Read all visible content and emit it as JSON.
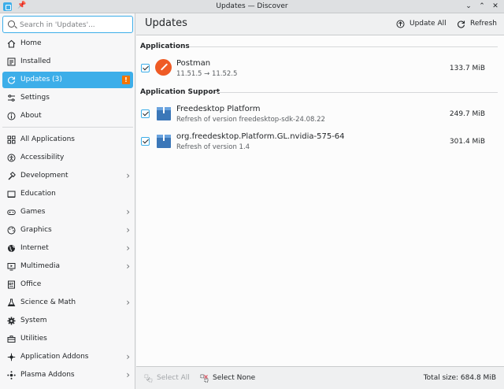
{
  "window": {
    "title": "Updates — Discover"
  },
  "search": {
    "placeholder": "Search in 'Updates'..."
  },
  "sidebar": {
    "items": [
      {
        "id": "home",
        "label": "Home",
        "icon": "home-icon"
      },
      {
        "id": "installed",
        "label": "Installed",
        "icon": "installed-icon"
      },
      {
        "id": "updates",
        "label": "Updates (3)",
        "icon": "updates-icon",
        "badge": "!"
      },
      {
        "id": "settings",
        "label": "Settings",
        "icon": "settings-icon"
      },
      {
        "id": "about",
        "label": "About",
        "icon": "info-icon"
      },
      {
        "id": "all-applications",
        "label": "All Applications",
        "icon": "grid-icon"
      },
      {
        "id": "accessibility",
        "label": "Accessibility",
        "icon": "accessibility-icon"
      },
      {
        "id": "development",
        "label": "Development",
        "icon": "hammer-icon"
      },
      {
        "id": "education",
        "label": "Education",
        "icon": "education-icon"
      },
      {
        "id": "games",
        "label": "Games",
        "icon": "gamepad-icon"
      },
      {
        "id": "graphics",
        "label": "Graphics",
        "icon": "palette-icon"
      },
      {
        "id": "internet",
        "label": "Internet",
        "icon": "globe-icon"
      },
      {
        "id": "multimedia",
        "label": "Multimedia",
        "icon": "multimedia-icon"
      },
      {
        "id": "office",
        "label": "Office",
        "icon": "office-icon"
      },
      {
        "id": "science",
        "label": "Science & Math",
        "icon": "flask-icon"
      },
      {
        "id": "system",
        "label": "System",
        "icon": "gear-icon"
      },
      {
        "id": "utilities",
        "label": "Utilities",
        "icon": "toolbox-icon"
      },
      {
        "id": "application-addons",
        "label": "Application Addons",
        "icon": "plugin-icon"
      },
      {
        "id": "plasma-addons",
        "label": "Plasma Addons",
        "icon": "plasma-icon"
      }
    ]
  },
  "header": {
    "title": "Updates",
    "update_all_label": "Update All",
    "refresh_label": "Refresh"
  },
  "sections": [
    {
      "title": "Applications",
      "items": [
        {
          "name": "Postman",
          "detail": "11.51.5 → 11.52.5",
          "size": "133.7 MiB",
          "checked": true
        }
      ]
    },
    {
      "title": "Application Support",
      "items": [
        {
          "name": "Freedesktop Platform",
          "detail": "Refresh of version freedesktop-sdk-24.08.22",
          "size": "249.7 MiB",
          "checked": true
        },
        {
          "name": "org.freedesktop.Platform.GL.nvidia-575-64",
          "detail": "Refresh of version 1.4",
          "size": "301.4 MiB",
          "checked": true
        }
      ]
    }
  ],
  "footer": {
    "select_all_label": "Select All",
    "select_none_label": "Select None",
    "total_size": "Total size: 684.8 MiB"
  },
  "colors": {
    "accent": "#3daee9",
    "badge": "#f67400",
    "postman": "#ef5b25",
    "package": "#3b77b8"
  }
}
